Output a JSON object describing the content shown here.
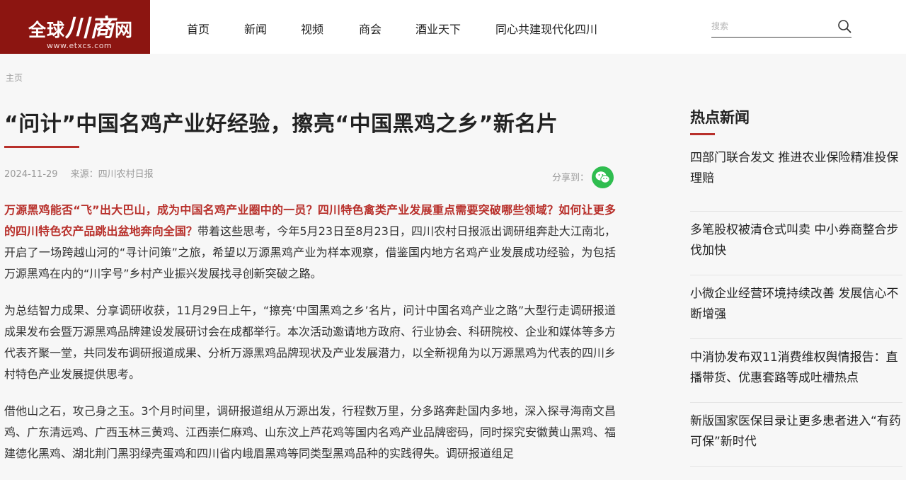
{
  "logo": {
    "brand": "全球",
    "brand_big": "川商",
    "brand_tail": "网",
    "url": "www.etxcs.com"
  },
  "nav": [
    "首页",
    "新闻",
    "视频",
    "商会",
    "酒业天下",
    "同心共建现代化四川"
  ],
  "search": {
    "placeholder": "搜索",
    "value": ""
  },
  "breadcrumb": "主页",
  "article": {
    "title": "“问计”中国名鸡产业好经验，擦亮“中国黑鸡之乡”新名片",
    "date": "2024-11-29",
    "source": "来源：四川农村日报",
    "share_label": "分享到：",
    "lead": "万源黑鸡能否“飞”出大巴山，成为中国名鸡产业圈中的一员？四川特色禽类产业发展重点需要突破哪些领域？如何让更多的四川特色农产品跳出盆地奔向全国？",
    "p1_rest": "带着这些思考，今年5月23日至8月23日，四川农村日报派出调研组奔赴大江南北，开启了一场跨越山河的“寻计问策”之旅，希望以万源黑鸡产业为样本观察，借鉴国内地方名鸡产业发展成功经验，为包括万源黑鸡在内的“川字号”乡村产业振兴发展找寻创新突破之路。",
    "p2": "为总结智力成果、分享调研收获，11月29日上午，“擦亮‘中国黑鸡之乡’名片，问计中国名鸡产业之路”大型行走调研报道成果发布会暨万源黑鸡品牌建设发展研讨会在成都举行。本次活动邀请地方政府、行业协会、科研院校、企业和媒体等多方代表齐聚一堂，共同发布调研报道成果、分析万源黑鸡品牌现状及产业发展潜力，以全新视角为以万源黑鸡为代表的四川乡村特色产业发展提供思考。",
    "p3": "借他山之石，攻己身之玉。3个月时间里，调研报道组从万源出发，行程数万里，分多路奔赴国内多地，深入探寻海南文昌鸡、广东清远鸡、广西玉林三黄鸡、江西崇仁麻鸡、山东汶上芦花鸡等国内名鸡产业品牌密码，同时探究安徽黄山黑鸡、福建德化黑鸡、湖北荆门黑羽绿壳蛋鸡和四川省内峨眉黑鸡等同类型黑鸡品种的实践得失。调研报道组足"
  },
  "sidebar": {
    "title": "热点新闻",
    "items": [
      "四部门联合发文 推进农业保险精准投保理赔",
      "多笔股权被清仓式叫卖 中小券商整合步伐加快",
      "小微企业经营环境持续改善 发展信心不断增强",
      "中消协发布双11消费维权舆情报告：直播带货、优惠套路等成吐槽热点",
      "新版国家医保目录让更多患者进入“有药可保”新时代"
    ]
  },
  "icons": {
    "search": "search-icon",
    "share": "wechat-icon"
  },
  "colors": {
    "brand": "#8c1511",
    "accent": "#b8302b",
    "wechat": "#2fbd4f"
  }
}
